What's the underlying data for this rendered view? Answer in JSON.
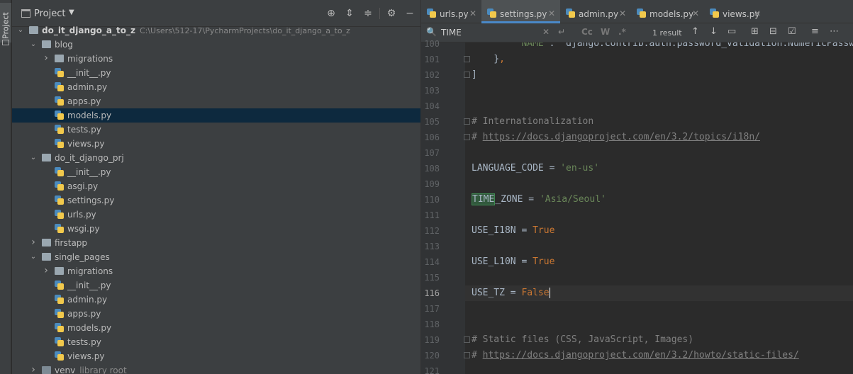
{
  "sidebar": {
    "tab_label": "Project"
  },
  "project_panel": {
    "title": "Project",
    "tree": [
      {
        "depth": 0,
        "expanded": true,
        "kind": "folder",
        "label": "do_it_django_a_to_z",
        "path": "C:\\Users\\512-17\\PycharmProjects\\do_it_django_a_to_z"
      },
      {
        "depth": 1,
        "expanded": true,
        "kind": "folder",
        "label": "blog"
      },
      {
        "depth": 2,
        "expanded": false,
        "kind": "folder",
        "label": "migrations"
      },
      {
        "depth": 2,
        "kind": "py",
        "label": "__init__.py"
      },
      {
        "depth": 2,
        "kind": "py",
        "label": "admin.py"
      },
      {
        "depth": 2,
        "kind": "py",
        "label": "apps.py"
      },
      {
        "depth": 2,
        "kind": "py",
        "label": "models.py",
        "selected": true
      },
      {
        "depth": 2,
        "kind": "py",
        "label": "tests.py"
      },
      {
        "depth": 2,
        "kind": "py",
        "label": "views.py"
      },
      {
        "depth": 1,
        "expanded": true,
        "kind": "folder",
        "label": "do_it_django_prj"
      },
      {
        "depth": 2,
        "kind": "py",
        "label": "__init__.py"
      },
      {
        "depth": 2,
        "kind": "py",
        "label": "asgi.py"
      },
      {
        "depth": 2,
        "kind": "py",
        "label": "settings.py"
      },
      {
        "depth": 2,
        "kind": "py",
        "label": "urls.py"
      },
      {
        "depth": 2,
        "kind": "py",
        "label": "wsgi.py"
      },
      {
        "depth": 1,
        "expanded": false,
        "kind": "folder",
        "label": "firstapp"
      },
      {
        "depth": 1,
        "expanded": true,
        "kind": "folder",
        "label": "single_pages"
      },
      {
        "depth": 2,
        "expanded": false,
        "kind": "folder",
        "label": "migrations"
      },
      {
        "depth": 2,
        "kind": "py",
        "label": "__init__.py"
      },
      {
        "depth": 2,
        "kind": "py",
        "label": "admin.py"
      },
      {
        "depth": 2,
        "kind": "py",
        "label": "apps.py"
      },
      {
        "depth": 2,
        "kind": "py",
        "label": "models.py"
      },
      {
        "depth": 2,
        "kind": "py",
        "label": "tests.py"
      },
      {
        "depth": 2,
        "kind": "py",
        "label": "views.py"
      },
      {
        "depth": 1,
        "expanded": false,
        "kind": "folder-dark",
        "label": "venv",
        "note": "library root"
      }
    ]
  },
  "editor_tabs": [
    {
      "name": "urls.py",
      "active": false
    },
    {
      "name": "settings.py",
      "active": true
    },
    {
      "name": "admin.py",
      "active": false
    },
    {
      "name": "models.py",
      "active": false
    },
    {
      "name": "views.py",
      "active": false
    }
  ],
  "find_bar": {
    "query": "TIME",
    "options": [
      "Cc",
      "W",
      ".*"
    ],
    "result_count": "1 result"
  },
  "code_lines": [
    {
      "n": "100",
      "text": "        'NAME': 'django.contrib.auth.password_validation.NumericPassw"
    },
    {
      "n": "101",
      "text": "    },"
    },
    {
      "n": "102",
      "text": "]"
    },
    {
      "n": "103",
      "text": ""
    },
    {
      "n": "104",
      "text": ""
    },
    {
      "n": "105",
      "text": "# Internationalization"
    },
    {
      "n": "106",
      "text": "# https://docs.djangoproject.com/en/3.2/topics/i18n/"
    },
    {
      "n": "107",
      "text": ""
    },
    {
      "n": "108",
      "text": "LANGUAGE_CODE = 'en-us'"
    },
    {
      "n": "109",
      "text": ""
    },
    {
      "n": "110",
      "text": "TIME_ZONE = 'Asia/Seoul'"
    },
    {
      "n": "111",
      "text": ""
    },
    {
      "n": "112",
      "text": "USE_I18N = True"
    },
    {
      "n": "113",
      "text": ""
    },
    {
      "n": "114",
      "text": "USE_L10N = True"
    },
    {
      "n": "115",
      "text": ""
    },
    {
      "n": "116",
      "text": "USE_TZ = False",
      "current": true
    },
    {
      "n": "117",
      "text": ""
    },
    {
      "n": "118",
      "text": ""
    },
    {
      "n": "119",
      "text": "# Static files (CSS, JavaScript, Images)"
    },
    {
      "n": "120",
      "text": "# https://docs.djangoproject.com/en/3.2/howto/static-files/"
    },
    {
      "n": "121",
      "text": ""
    }
  ]
}
